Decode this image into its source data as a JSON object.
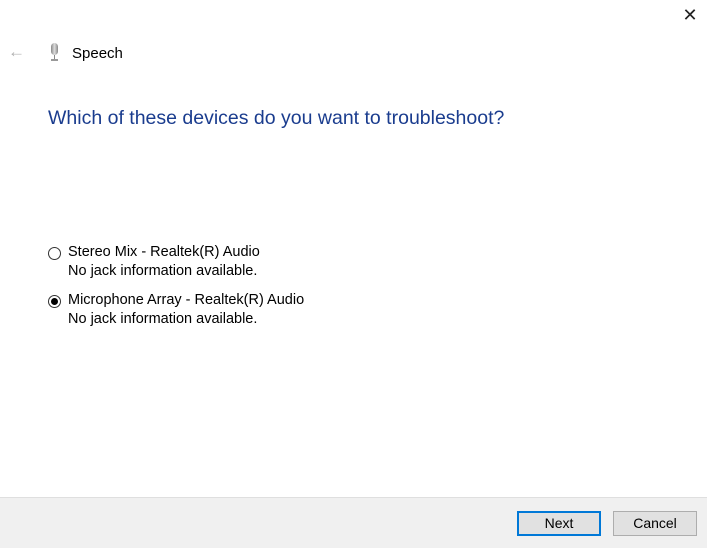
{
  "window": {
    "title": "Speech",
    "close_glyph": "✕",
    "back_glyph": "←"
  },
  "heading": "Which of these devices do you want to troubleshoot?",
  "devices": [
    {
      "name": "Stereo Mix - Realtek(R) Audio",
      "detail": "No jack information available.",
      "selected": false
    },
    {
      "name": "Microphone Array - Realtek(R) Audio",
      "detail": "No jack information available.",
      "selected": true
    }
  ],
  "buttons": {
    "next": "Next",
    "cancel": "Cancel"
  },
  "colors": {
    "heading": "#1a3c8e",
    "focus": "#0078d7"
  }
}
